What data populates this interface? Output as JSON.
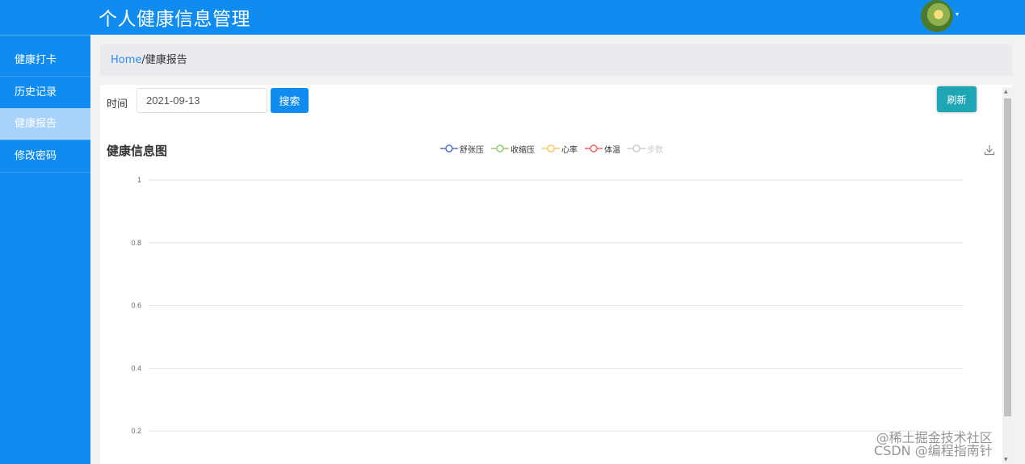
{
  "header": {
    "title": "个人健康信息管理",
    "avatar_caret": "▾"
  },
  "sidebar": {
    "items": [
      {
        "label": "健康打卡",
        "active": false
      },
      {
        "label": "历史记录",
        "active": false
      },
      {
        "label": "健康报告",
        "active": true
      },
      {
        "label": "修改密码",
        "active": false
      }
    ]
  },
  "breadcrumb": {
    "home": "Home",
    "separator": "/",
    "current": "健康报告"
  },
  "filter": {
    "time_label": "时间",
    "date_value": "2021-09-13",
    "search_label": "搜索",
    "refresh_label": "刷新"
  },
  "chart_data": {
    "type": "line",
    "title": "健康信息图",
    "series": [
      {
        "name": "舒张压",
        "color": "#5470c6",
        "values": [],
        "visible": true
      },
      {
        "name": "收缩压",
        "color": "#91cc75",
        "values": [],
        "visible": true
      },
      {
        "name": "心率",
        "color": "#fac858",
        "values": [],
        "visible": true
      },
      {
        "name": "体温",
        "color": "#ee6666",
        "values": [],
        "visible": true
      },
      {
        "name": "步数",
        "color": "#cccccc",
        "values": [],
        "visible": false
      }
    ],
    "y_ticks": [
      "1",
      "0.8",
      "0.6",
      "0.4",
      "0.2"
    ],
    "ylim": [
      0,
      1
    ],
    "grid": true,
    "legend_position": "top-center"
  },
  "watermark": {
    "line1": "@稀土掘金技术社区",
    "line2": "CSDN @编程指南针"
  },
  "colors": {
    "primary": "#108cf0",
    "refresh": "#1ea6b4",
    "active_sidebar": "#a9d2f9"
  }
}
